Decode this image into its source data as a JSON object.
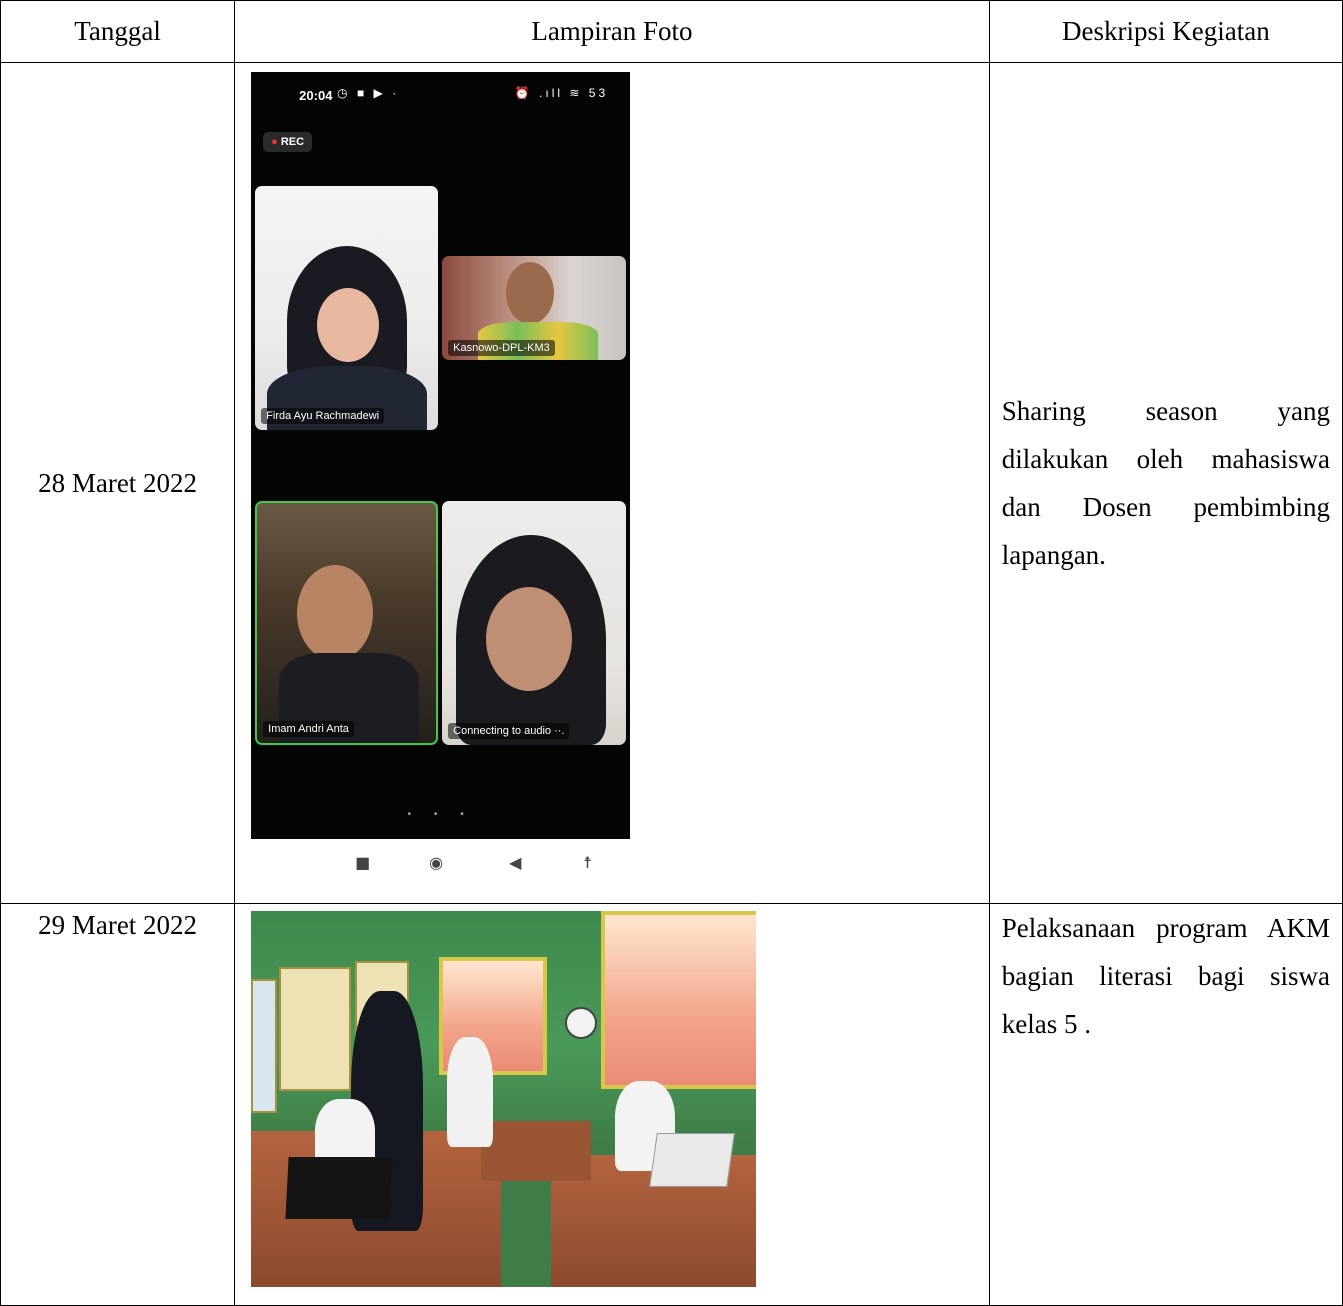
{
  "table": {
    "headers": {
      "date": "Tanggal",
      "photo": "Lampiran Foto",
      "description": "Deskripsi Kegiatan"
    },
    "rows": [
      {
        "date": "28 Maret 2022",
        "description": "Sharing season yang dilakukan oleh mahasiswa dan Dosen pembimbing lapangan.",
        "photo": {
          "status_time": "20:04",
          "status_icons": "◷ ■ ▶ ·",
          "status_right": "⏰ .ıll ≋ 53",
          "rec_label": "REC",
          "participants": [
            "Firda Ayu Rachmadewi",
            "Kasnowo-DPL-KM3",
            "Imam Andri Anta",
            "Connecting to audio ··."
          ],
          "pager": "• • •"
        }
      },
      {
        "date": "29 Maret 2022",
        "description": "Pelaksanaan program AKM bagian literasi bagi siswa kelas 5 ."
      }
    ]
  }
}
